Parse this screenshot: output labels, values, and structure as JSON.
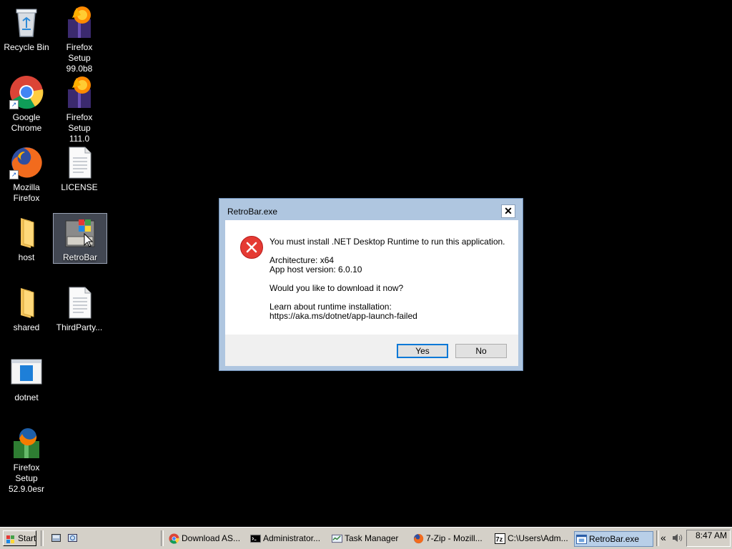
{
  "desktop": {
    "icons": [
      {
        "label": "Recycle Bin"
      },
      {
        "label": "Firefox Setup\n99.0b8"
      },
      {
        "label": "Google\nChrome"
      },
      {
        "label": "Firefox Setup\n111.0"
      },
      {
        "label": "Mozilla\nFirefox"
      },
      {
        "label": "LICENSE"
      },
      {
        "label": "host"
      },
      {
        "label": "RetroBar"
      },
      {
        "label": "shared"
      },
      {
        "label": "ThirdParty..."
      },
      {
        "label": "dotnet"
      },
      {
        "label": "Firefox Setup\n52.9.0esr"
      }
    ]
  },
  "dialog": {
    "title": "RetroBar.exe",
    "close_label": "✕",
    "message_line1": "You must install .NET Desktop Runtime to run this application.",
    "architecture": "Architecture: x64",
    "host_version": "App host version: 6.0.10",
    "question": "Would you like to download it now?",
    "learn_about": "Learn about runtime installation:",
    "link": "https://aka.ms/dotnet/app-launch-failed",
    "yes_label": "Yes",
    "no_label": "No"
  },
  "taskbar": {
    "start_label": "Start",
    "buttons": [
      {
        "label": "Download AS...",
        "icon": "chrome-icon"
      },
      {
        "label": "Administrator...",
        "icon": "cmd-icon"
      },
      {
        "label": "Task Manager",
        "icon": "task-manager-icon"
      },
      {
        "label": "7-Zip - Mozill...",
        "icon": "firefox-icon"
      },
      {
        "label": "C:\\Users\\Adm...",
        "icon": "7zip-icon"
      },
      {
        "label": "RetroBar.exe",
        "icon": "window-icon"
      }
    ],
    "clock": "8:47 AM"
  }
}
